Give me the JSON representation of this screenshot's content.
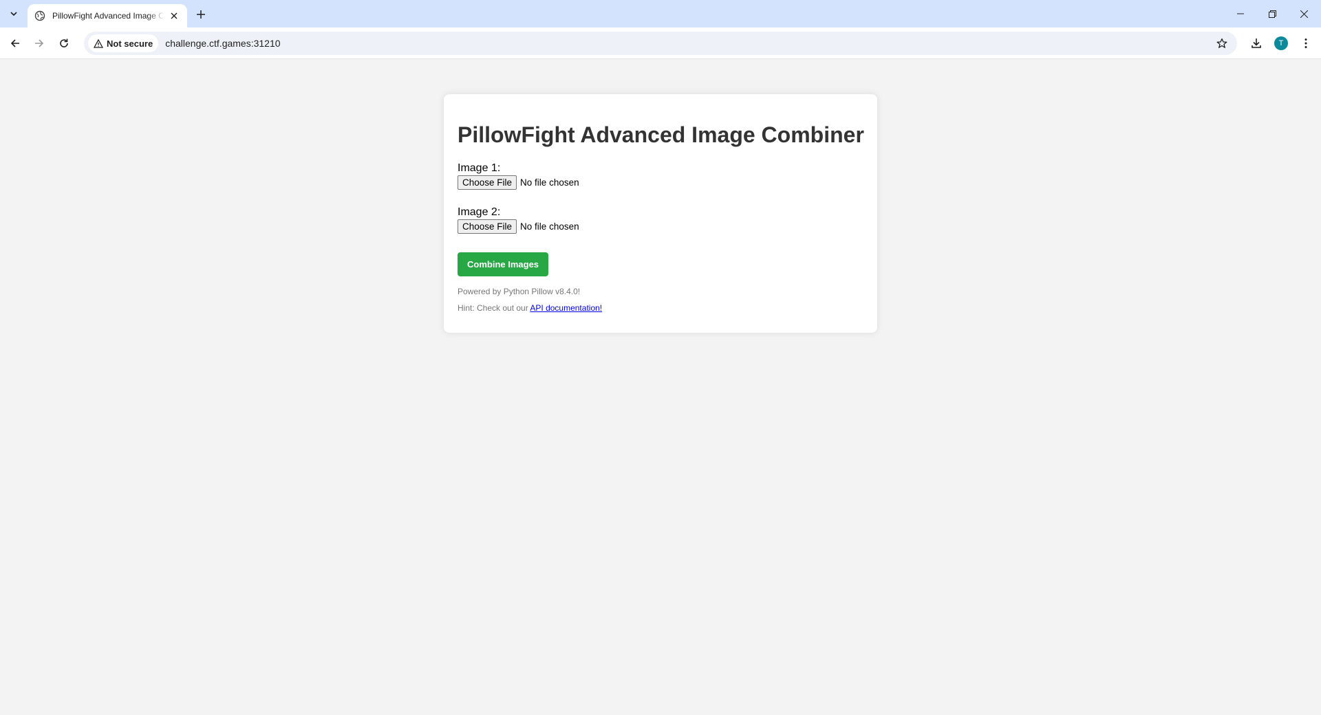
{
  "browser": {
    "tab_title": "PillowFight Advanced Image Combiner",
    "security_label": "Not secure",
    "url": "challenge.ctf.games:31210",
    "profile_initial": "T",
    "icons": {
      "tab_search": "chevron-down-icon",
      "favicon": "globe-icon",
      "tab_close": "close-icon",
      "new_tab": "plus-icon",
      "minimize": "minimize-icon",
      "restore": "restore-icon",
      "close_window": "close-icon",
      "back": "arrow-left-icon",
      "forward": "arrow-right-icon",
      "reload": "reload-icon",
      "warning": "warning-triangle-icon",
      "bookmark": "star-icon",
      "downloads": "download-icon",
      "menu": "kebab-menu-icon"
    },
    "colors": {
      "tabstrip": "#d3e3fd",
      "omnibox": "#eef1f8",
      "avatar": "#0b8a9b"
    }
  },
  "page": {
    "title": "PillowFight Advanced Image Combiner",
    "fields": [
      {
        "label": "Image 1:",
        "button": "Choose File",
        "status": "No file chosen"
      },
      {
        "label": "Image 2:",
        "button": "Choose File",
        "status": "No file chosen"
      }
    ],
    "submit_label": "Combine Images",
    "powered_by": "Powered by Python Pillow v8.4.0!",
    "hint_prefix": "Hint: Check out our ",
    "hint_link": "API documentation!",
    "colors": {
      "background": "#f3f3f3",
      "card": "#ffffff",
      "submit": "#28a745",
      "link": "#0000ee"
    }
  }
}
